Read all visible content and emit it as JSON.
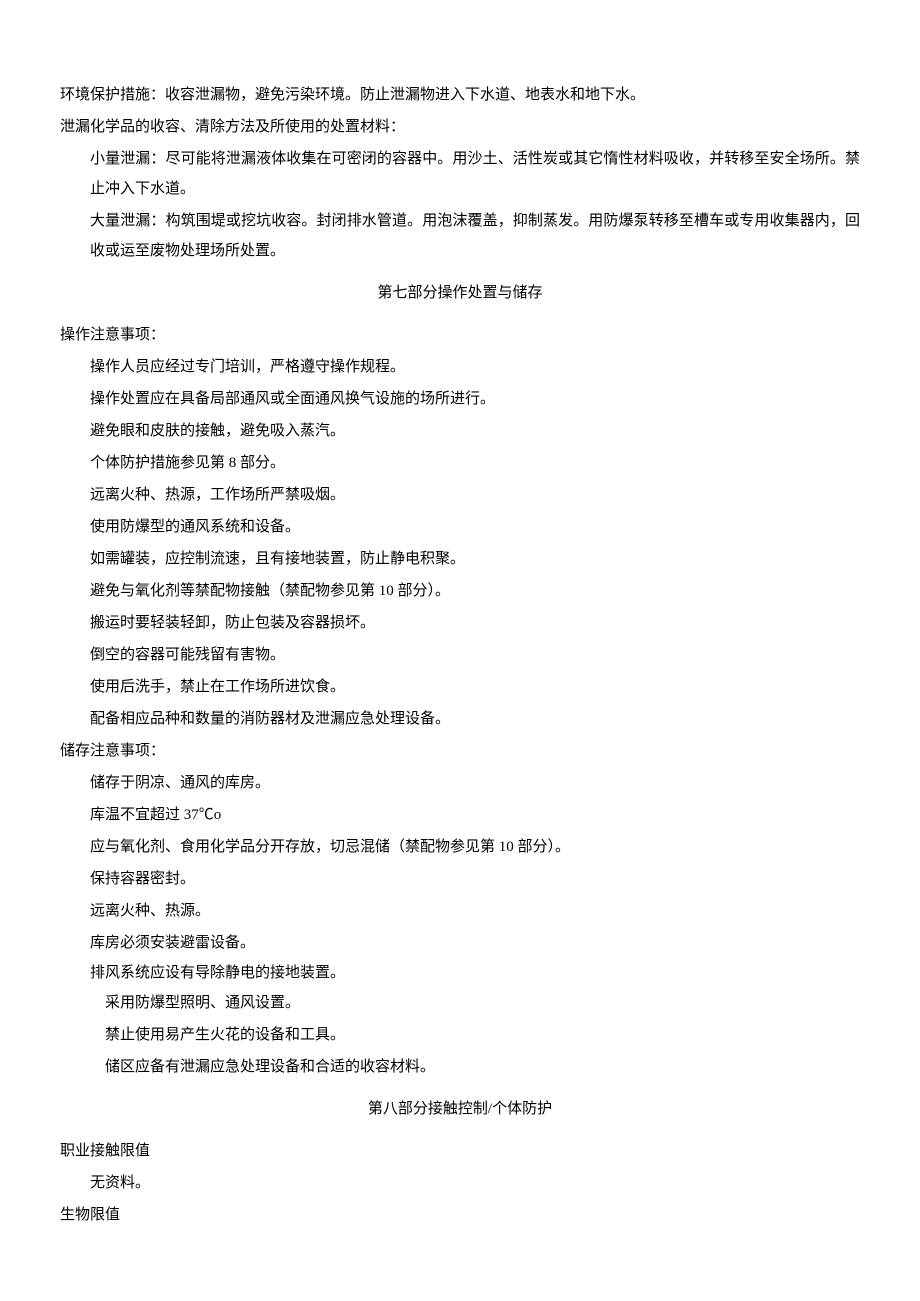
{
  "section6": {
    "envProtection": "环境保护措施：收容泄漏物，避免污染环境。防止泄漏物进入下水道、地表水和地下水。",
    "cleanupHeader": "泄漏化学品的收容、清除方法及所使用的处置材料：",
    "smallLeak": "小量泄漏：尽可能将泄漏液体收集在可密闭的容器中。用沙土、活性炭或其它惰性材料吸收，并转移至安全场所。禁止冲入下水道。",
    "largeLeak": "大量泄漏：构筑围堤或挖坑收容。封闭排水管道。用泡沫覆盖，抑制蒸发。用防爆泵转移至槽车或专用收集器内，回收或运至废物处理场所处置。"
  },
  "section7": {
    "title": "第七部分操作处置与储存",
    "operationHeader": "操作注意事项：",
    "operationItems": [
      "操作人员应经过专门培训，严格遵守操作规程。",
      "操作处置应在具备局部通风或全面通风换气设施的场所进行。",
      "避免眼和皮肤的接触，避免吸入蒸汽。",
      "个体防护措施参见第 8 部分。",
      "远离火种、热源，工作场所严禁吸烟。",
      "使用防爆型的通风系统和设备。",
      "如需罐装，应控制流速，且有接地装置，防止静电积聚。",
      "避免与氧化剂等禁配物接触（禁配物参见第 10 部分）。",
      "搬运时要轻装轻卸，防止包装及容器损坏。",
      "倒空的容器可能残留有害物。",
      "使用后洗手，禁止在工作场所进饮食。",
      "配备相应品种和数量的消防器材及泄漏应急处理设备。"
    ],
    "storageHeader": "储存注意事项：",
    "storageItems": [
      "储存于阴凉、通风的库房。",
      "库温不宜超过 37℃o",
      "应与氧化剂、食用化学品分开存放，切忌混储（禁配物参见第 10 部分）。",
      "保持容器密封。",
      "远离火种、热源。",
      "库房必须安装避雷设备。",
      "排风系统应设有导除静电的接地装置。"
    ],
    "storageItemsIndent": [
      "采用防爆型照明、通风设置。",
      "禁止使用易产生火花的设备和工具。",
      "储区应备有泄漏应急处理设备和合适的收容材料。"
    ]
  },
  "section8": {
    "title": "第八部分接触控制/个体防护",
    "occupationalLimitHeader": "职业接触限值",
    "noData": "无资料。",
    "bioLimitHeader": "生物限值"
  }
}
